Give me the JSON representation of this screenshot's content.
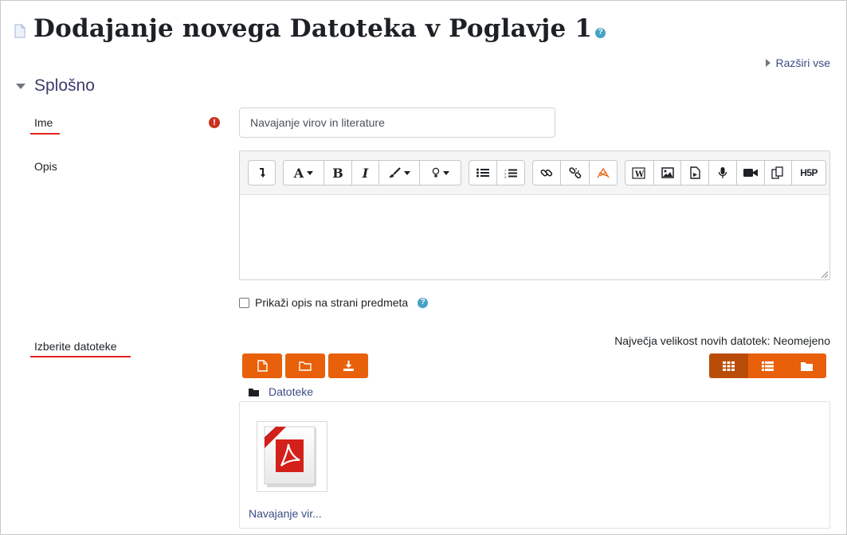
{
  "page": {
    "title": "Dodajanje novega Datoteka v Poglavje 1",
    "expand_all": "Razširi vse"
  },
  "section": {
    "title": "Splošno"
  },
  "form": {
    "name_label": "Ime",
    "name_value": "Navajanje virov in literature",
    "description_label": "Opis",
    "show_description_label": "Prikaži opis na strani predmeta",
    "show_description_checked": false,
    "select_files_label": "Izberite datoteke",
    "max_size_text": "Največja velikost novih datotek: Neomejeno"
  },
  "editor": {
    "toolbar_icons": [
      [
        "toggle-toolbar-icon"
      ],
      [
        "font-style-icon",
        "bold-icon",
        "italic-icon",
        "text-color-icon",
        "highlight-icon"
      ],
      [
        "unordered-list-icon",
        "ordered-list-icon"
      ],
      [
        "link-icon",
        "unlink-icon",
        "accessibility-checker-icon"
      ],
      [
        "paste-word-icon",
        "image-icon",
        "media-icon",
        "record-audio-icon",
        "record-video-icon",
        "manage-files-icon",
        "h5p-icon"
      ]
    ],
    "h5p_text": "H5P",
    "font_letter": "A",
    "bold_letter": "B",
    "italic_letter": "I",
    "content": ""
  },
  "filemanager": {
    "breadcrumb": "Datoteke",
    "current_view": "grid",
    "files": [
      {
        "name": "Navajanje vir...",
        "type": "pdf"
      }
    ]
  },
  "colors": {
    "accent": "#e8600a",
    "accent_active": "#b94c08",
    "link": "#3b4d86",
    "help": "#46a2c6",
    "required": "#ca3120",
    "annotation_underline": "#e02222"
  }
}
